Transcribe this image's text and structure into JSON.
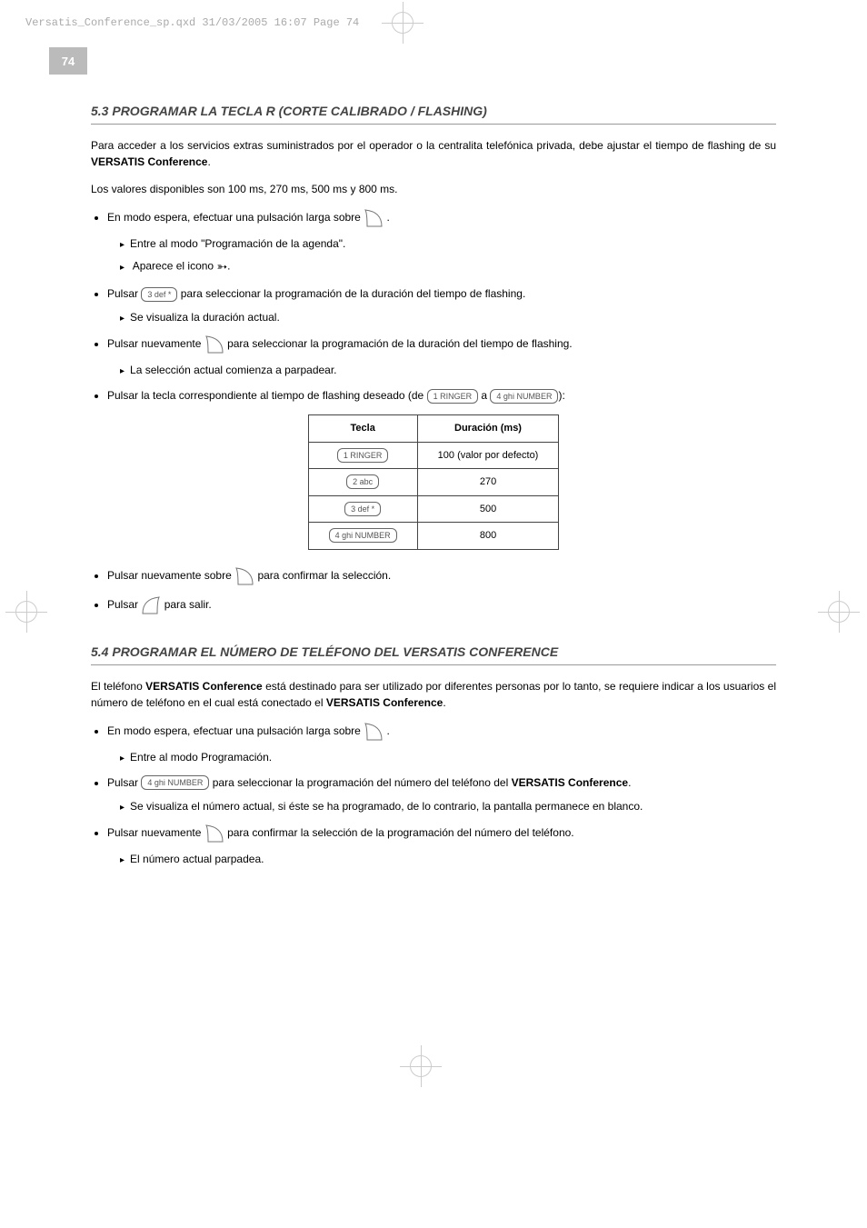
{
  "header_line": "Versatis_Conference_sp.qxd  31/03/2005  16:07  Page 74",
  "page_number": "74",
  "section53": {
    "heading": "5.3    PROGRAMAR LA TECLA R (CORTE CALIBRADO / FLASHING)",
    "intro_a": "Para acceder a los servicios extras suministrados por el operador o la centralita telefónica privada, debe ajustar el tiempo de flashing de su ",
    "intro_bold": "VERSATIS Conference",
    "intro_b": ".",
    "values_line": "Los valores disponibles son 100 ms, 270 ms, 500 ms y 800 ms.",
    "b1": "En modo espera, efectuar una pulsación larga sobre ",
    "b1_sub1": "Entre al modo \"Programación de la agenda\".",
    "b1_sub2a": "Aparece el icono ",
    "b1_sub2b": ".",
    "b2a": "Pulsar ",
    "b2b": " para seleccionar la programación de la duración del tiempo de flashing.",
    "b2_sub": "Se visualiza la duración actual.",
    "b3a": "Pulsar nuevamente ",
    "b3b": " para seleccionar la programación de la duración del tiempo de flashing.",
    "b3_sub": "La selección actual comienza a parpadear.",
    "b4a": "Pulsar la tecla correspondiente al tiempo de flashing deseado (de ",
    "b4b": " a ",
    "b4c": "):",
    "table": {
      "h1": "Tecla",
      "h2": "Duración (ms)",
      "rows": [
        {
          "key": "1 RINGER",
          "dur": "100 (valor por defecto)"
        },
        {
          "key": "2 abc",
          "dur": "270"
        },
        {
          "key": "3 def *",
          "dur": "500"
        },
        {
          "key": "4 ghi NUMBER",
          "dur": "800"
        }
      ]
    },
    "b5a": "Pulsar nuevamente sobre ",
    "b5b": " para confirmar la selección.",
    "b6a": "Pulsar ",
    "b6b": " para salir."
  },
  "section54": {
    "heading": "5.4    PROGRAMAR EL NÚMERO DE TELÉFONO DEL VERSATIS CONFERENCE",
    "intro_a": "El teléfono ",
    "intro_bold1": "VERSATIS Conference",
    "intro_b": " está destinado para ser utilizado por diferentes personas por lo tanto, se requiere indicar a los usuarios el número de teléfono en el cual está conectado el ",
    "intro_bold2": "VERSATIS Conference",
    "intro_c": ".",
    "b1": "En modo espera, efectuar una pulsación larga sobre ",
    "b1_sub": "Entre al modo Programación.",
    "b2a": "Pulsar ",
    "b2b": " para seleccionar la programación del número del teléfono del ",
    "b2_bold": "VERSATIS Conference",
    "b2c": ".",
    "b2_sub": "Se visualiza el número actual, si éste se ha programado, de lo contrario, la pantalla permanece en blanco.",
    "b3a": "Pulsar nuevamente ",
    "b3b": " para confirmar la selección de la programación del número del teléfono.",
    "b3_sub": "El número actual parpadea."
  },
  "icons": {
    "menu_key": "MENU",
    "key1": "1 RINGER",
    "key3": "3 def *",
    "key4": "4 ghi NUMBER",
    "exit_key": "EXIT",
    "send_arrow": "➳"
  }
}
